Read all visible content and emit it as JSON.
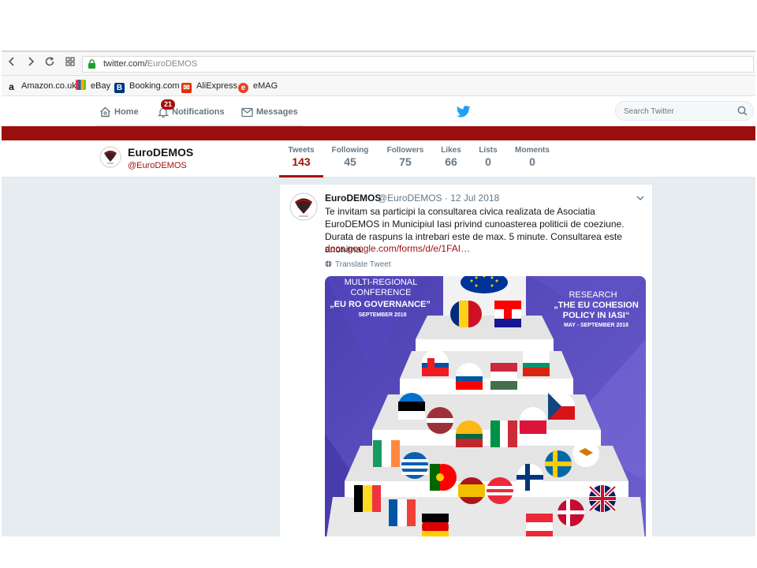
{
  "browser": {
    "url_domain": "twitter.com/",
    "url_path": "EuroDEMOS",
    "bookmarks": [
      {
        "label": "Amazon.co.uk",
        "icon": "amazon-icon",
        "color": "#222222"
      },
      {
        "label": "eBay",
        "icon": "ebay-icon",
        "color": "#e53238"
      },
      {
        "label": "Booking.com",
        "icon": "booking-icon",
        "color": "#003580"
      },
      {
        "label": "AliExpress",
        "icon": "aliexpress-icon",
        "color": "#e62e04"
      },
      {
        "label": "eMAG",
        "icon": "emag-icon",
        "color": "#e8412b"
      }
    ]
  },
  "twitter_nav": {
    "home": "Home",
    "notifications": "Notifications",
    "notifications_count": "21",
    "messages": "Messages",
    "search_placeholder": "Search Twitter"
  },
  "profile": {
    "name": "EuroDEMOS",
    "handle": "@EuroDEMOS",
    "stats": [
      {
        "label": "Tweets",
        "value": "143",
        "active": true
      },
      {
        "label": "Following",
        "value": "45"
      },
      {
        "label": "Followers",
        "value": "75"
      },
      {
        "label": "Likes",
        "value": "66"
      },
      {
        "label": "Lists",
        "value": "0"
      },
      {
        "label": "Moments",
        "value": "0"
      }
    ]
  },
  "tweet": {
    "name": "EuroDEMOS",
    "meta": "@EuroDEMOS · 12 Jul 2018",
    "body": "Te invitam sa participi la consultarea civica realizata de Asociatia EuroDEMOS in Municipiul Iasi privind cunoasterea politicii de coeziune. Durata de raspuns la intrebari este de max. 5 minute. Consultarea este anonima.",
    "link": "docs.google.com/forms/d/e/1FAI…",
    "translate": "Translate Tweet",
    "media": {
      "left_title": "MULTI-REGIONAL CONFERENCE",
      "left_sub": "„EU RO GOVERNANCE”",
      "left_date": "SEPTEMBER 2018",
      "right_title": "RESEARCH",
      "right_sub": "„THE EU COHESION POLICY IN IASI“",
      "right_date": "MAY - SEPTEMBER 2018"
    }
  },
  "colors": {
    "brand": "#a50d0d",
    "banner": "#9b0e0e",
    "twitter_blue": "#1da1f2",
    "media_bg": "#5a4fb8"
  }
}
